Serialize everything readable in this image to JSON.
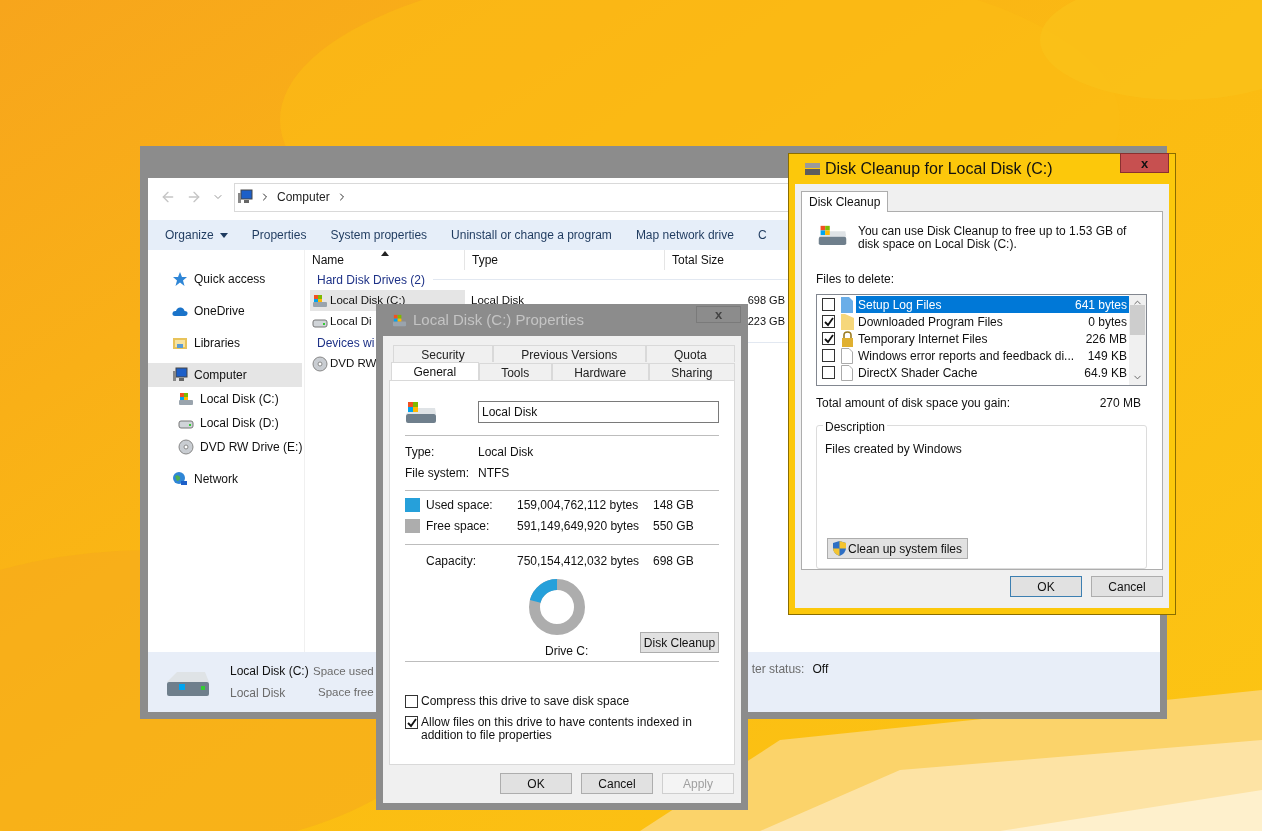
{
  "explorer": {
    "address": {
      "crumbs": [
        "Computer"
      ]
    },
    "commands": [
      {
        "label": "Organize",
        "menu": true
      },
      {
        "label": "Properties",
        "menu": false
      },
      {
        "label": "System properties",
        "menu": false
      },
      {
        "label": "Uninstall or change a program",
        "menu": false
      },
      {
        "label": "Map network drive",
        "menu": false
      },
      {
        "label": "C",
        "menu": false
      }
    ],
    "columns": [
      {
        "label": "Name",
        "sorted": true
      },
      {
        "label": "Type",
        "sorted": false
      },
      {
        "label": "Total Size",
        "sorted": false
      }
    ],
    "nav": [
      {
        "label": "Quick access",
        "kind": "star",
        "selected": false
      },
      {
        "label": "OneDrive",
        "kind": "cloud",
        "selected": false
      },
      {
        "label": "Libraries",
        "kind": "library",
        "selected": false
      },
      {
        "label": "Computer",
        "kind": "computer",
        "selected": true,
        "children": [
          {
            "label": "Local Disk (C:)",
            "kind": "system-disk",
            "selected": false
          },
          {
            "label": "Local Disk (D:)",
            "kind": "disk",
            "selected": false
          },
          {
            "label": "DVD RW Drive (E:)",
            "kind": "dvd",
            "selected": false
          }
        ]
      },
      {
        "label": "Network",
        "kind": "network",
        "selected": false
      }
    ],
    "groups": [
      {
        "title": "Hard Disk Drives (2)",
        "items": [
          {
            "name": "Local Disk (C:)",
            "kind": "system-disk",
            "type": "Local Disk",
            "size": "698 GB",
            "selected": true
          },
          {
            "name": "Local Di",
            "kind": "disk",
            "size": "223 GB",
            "selected": false
          }
        ]
      },
      {
        "title": "Devices wi",
        "items": [
          {
            "name": "DVD RW",
            "kind": "dvd",
            "selected": false
          }
        ]
      }
    ],
    "status": {
      "name": "Local Disk (C:)",
      "type": "Local Disk",
      "fields": [
        "Space used",
        "Space free"
      ],
      "extra_label": "ter status:",
      "extra_value": "Off"
    }
  },
  "properties": {
    "title": "Local Disk (C:) Properties",
    "close": "x",
    "tab_rows": [
      [
        {
          "label": "Security",
          "selected": false
        },
        {
          "label": "Previous Versions",
          "selected": false
        },
        {
          "label": "Quota",
          "selected": false
        }
      ],
      [
        {
          "label": "General",
          "selected": true
        },
        {
          "label": "Tools",
          "selected": false
        },
        {
          "label": "Hardware",
          "selected": false
        },
        {
          "label": "Sharing",
          "selected": false
        }
      ]
    ],
    "name_value": "Local Disk",
    "fields": [
      {
        "label": "Type:",
        "value": "Local Disk"
      },
      {
        "label": "File system:",
        "value": "NTFS"
      }
    ],
    "space": [
      {
        "label": "Used space:",
        "bytes": "159,004,762,112 bytes",
        "size": "148 GB",
        "color": "#26a0da"
      },
      {
        "label": "Free space:",
        "bytes": "591,149,649,920 bytes",
        "size": "550 GB",
        "color": "#adadad"
      }
    ],
    "capacity": {
      "label": "Capacity:",
      "bytes": "750,154,412,032 bytes",
      "size": "698 GB"
    },
    "usage": {
      "level": 0.21
    },
    "drive_label": "Drive C:",
    "cleanup_button": "Disk Cleanup",
    "options": [
      {
        "label": "Compress this drive to save disk space",
        "checked": false
      },
      {
        "label": "Allow files on this drive to have contents indexed in addition to file properties",
        "checked": true
      }
    ],
    "buttons": [
      {
        "label": "OK",
        "disabled": false
      },
      {
        "label": "Cancel",
        "disabled": false
      },
      {
        "label": "Apply",
        "disabled": true
      }
    ]
  },
  "cleanup": {
    "title": "Disk Cleanup for Local Disk (C:)",
    "close": "x",
    "tab": "Disk Cleanup",
    "intro": "You can use Disk Cleanup to free up to 1.53 GB of disk space on Local Disk (C:).",
    "files_label": "Files to delete:",
    "files": [
      {
        "name": "Setup Log Files",
        "size": "641 bytes",
        "kind": "log",
        "checked": false,
        "selected": true
      },
      {
        "name": "Downloaded Program Files",
        "size": "0 bytes",
        "kind": "folder",
        "checked": true,
        "selected": false
      },
      {
        "name": "Temporary Internet Files",
        "size": "226 MB",
        "kind": "lock",
        "checked": true,
        "selected": false
      },
      {
        "name": "Windows error reports and feedback di...",
        "size": "149 KB",
        "kind": "file",
        "checked": false,
        "selected": false
      },
      {
        "name": "DirectX Shader Cache",
        "size": "64.9 KB",
        "kind": "file",
        "checked": false,
        "selected": false
      }
    ],
    "total_label": "Total amount of disk space you gain:",
    "total": "270 MB",
    "description_title": "Description",
    "description": "Files created by Windows",
    "system_button": "Clean up system files",
    "buttons": [
      {
        "label": "OK",
        "default": true
      },
      {
        "label": "Cancel",
        "default": false
      }
    ]
  }
}
